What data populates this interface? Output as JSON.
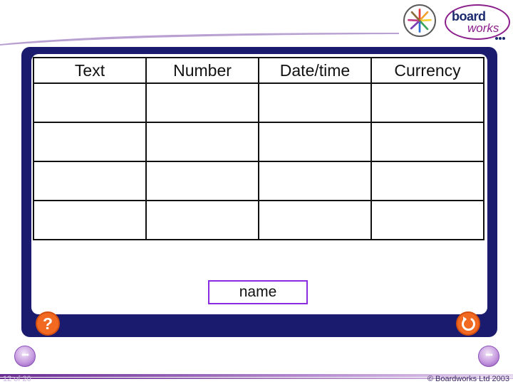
{
  "logo": {
    "brand_top": "board",
    "brand_bottom": "works"
  },
  "table": {
    "headers": [
      "Text",
      "Number",
      "Date/time",
      "Currency"
    ],
    "rows": [
      [
        "",
        "",
        "",
        ""
      ],
      [
        "",
        "",
        "",
        ""
      ],
      [
        "",
        "",
        "",
        ""
      ],
      [
        "",
        "",
        "",
        ""
      ]
    ]
  },
  "drag_item": {
    "label": "name"
  },
  "buttons": {
    "help_label": "?"
  },
  "footer": {
    "page": "12 of 20",
    "copyright": "© Boardworks Ltd 2003"
  },
  "colors": {
    "frame": "#1a1a6e",
    "button_orange": "#f26a22",
    "tile_border": "#8b2be2",
    "accent_purple": "#8b1f8b"
  }
}
